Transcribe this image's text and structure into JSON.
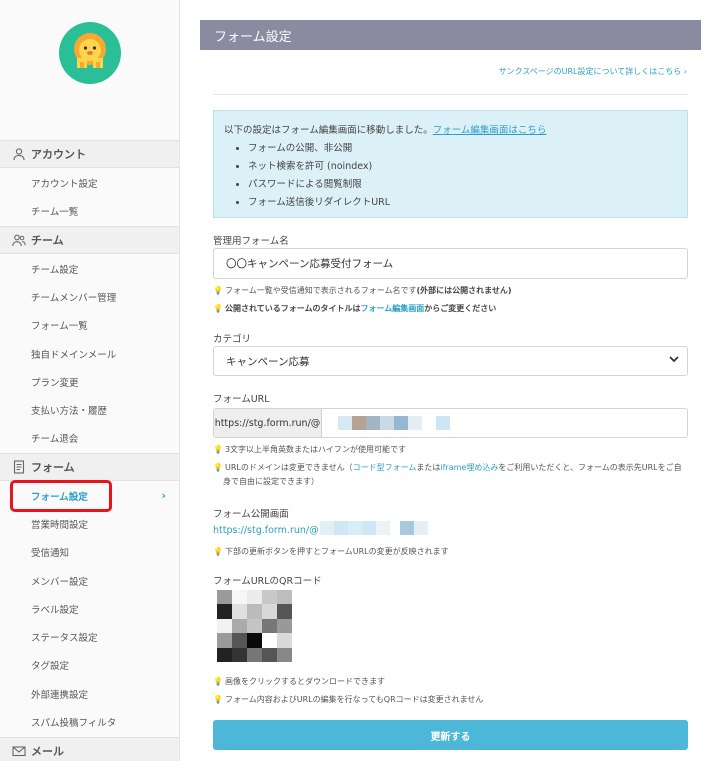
{
  "sidebar": {
    "sections": {
      "account": "アカウント",
      "team": "チーム",
      "form": "フォーム",
      "mail": "メール"
    },
    "items": {
      "account_settings": "アカウント設定",
      "team_list": "チーム一覧",
      "team_settings": "チーム設定",
      "team_member_mgmt": "チームメンバー管理",
      "form_list": "フォーム一覧",
      "custom_domain_mail": "独自ドメインメール",
      "plan_change": "プラン変更",
      "payment_history": "支払い方法・履歴",
      "team_leave": "チーム退会",
      "form_settings": "フォーム設定",
      "business_hours": "営業時間設定",
      "notification": "受信通知",
      "member_settings": "メンバー設定",
      "label_settings": "ラベル設定",
      "status_settings": "ステータス設定",
      "tag_settings": "タグ設定",
      "external_integration": "外部連携設定",
      "spam_filter": "スパム投稿フィルタ"
    },
    "active_chevron": "›",
    "highlight_color": "#e8141b"
  },
  "main": {
    "page_title": "フォーム設定",
    "thanks_link": "サンクスページのURL設定について詳しくはこちら ›",
    "info": {
      "lead": "以下の設定はフォーム編集画面に移動しました。",
      "lead_link": "フォーム編集画面はこちら",
      "bullets": [
        "フォームの公開、非公開",
        "ネット検索を許可 (noindex)",
        "パスワードによる閲覧制限",
        "フォーム送信後リダイレクトURL"
      ]
    },
    "admin_name": {
      "label": "管理用フォーム名",
      "value": "〇〇キャンペーン応募受付フォーム",
      "hint1_pre": "フォーム一覧や受信通知で表示されるフォーム名です",
      "hint1_bold": "(外部には公開されません)",
      "hint2_pre": "公開されているフォームのタイトルは",
      "hint2_link": "フォーム編集画面",
      "hint2_post": "からご変更ください"
    },
    "category": {
      "label": "カテゴリ",
      "value": "キャンペーン応募",
      "chevron": "⌄"
    },
    "form_url": {
      "label": "フォームURL",
      "prefix": "https://stg.form.run/@",
      "hint1": "3文字以上半角英数またはハイフンが使用可能です",
      "hint2_pre": "URLのドメインは変更できません（",
      "hint2_link1": "コード型フォーム",
      "hint2_mid": "または",
      "hint2_link2": "iframe埋め込み",
      "hint2_post": "をご利用いただくと、フォームの表示先URLをご自身で自由に設定できます）"
    },
    "public_url": {
      "label": "フォーム公開画面",
      "value": "https://stg.form.run/@",
      "hint": "下部の更新ボタンを押すとフォームURLの変更が反映されます"
    },
    "qr": {
      "label": "フォームURLのQRコード",
      "hint1": "画像をクリックするとダウンロードできます",
      "hint2": "フォーム内容およびURLの編集を行なってもQRコードは変更されません"
    },
    "submit_label": "更新する",
    "accent_color": "#2c9fc7",
    "button_color": "#4cb7d8",
    "title_bar_color": "#8a8aa0"
  }
}
